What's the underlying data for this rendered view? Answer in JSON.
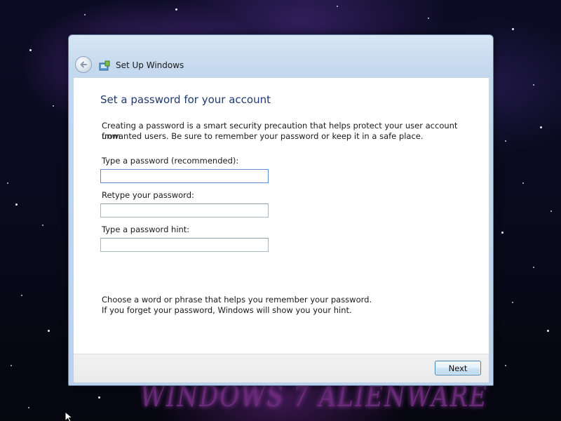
{
  "window": {
    "title": "Set Up Windows"
  },
  "page": {
    "heading": "Set a password for your account",
    "intro_line_1": "Creating a password is a smart security precaution that helps protect your user account from",
    "intro_line_2": "unwanted users. Be sure to remember your password or keep it in a safe place.",
    "hint_line_1": "Choose a word or phrase that helps you remember your password.",
    "hint_line_2": "If you forget your password, Windows will show you your hint."
  },
  "fields": {
    "password_label": "Type a password (recommended):",
    "password_value": "",
    "retype_label": "Retype your password:",
    "retype_value": "",
    "hint_label": "Type a password hint:",
    "hint_value": ""
  },
  "footer": {
    "next_label": "Next"
  },
  "wallpaper": {
    "brand_text": "WINDOWS 7 ALIENWARE"
  },
  "icons": {
    "back": "back-arrow-icon",
    "setup": "setup-windows-icon",
    "cursor": "mouse-cursor-icon",
    "logo": "alien-head-logo"
  },
  "colors": {
    "heading": "#1e3a70",
    "accent_border": "#3c7fb1",
    "window_frame": "#bcd2ea"
  }
}
